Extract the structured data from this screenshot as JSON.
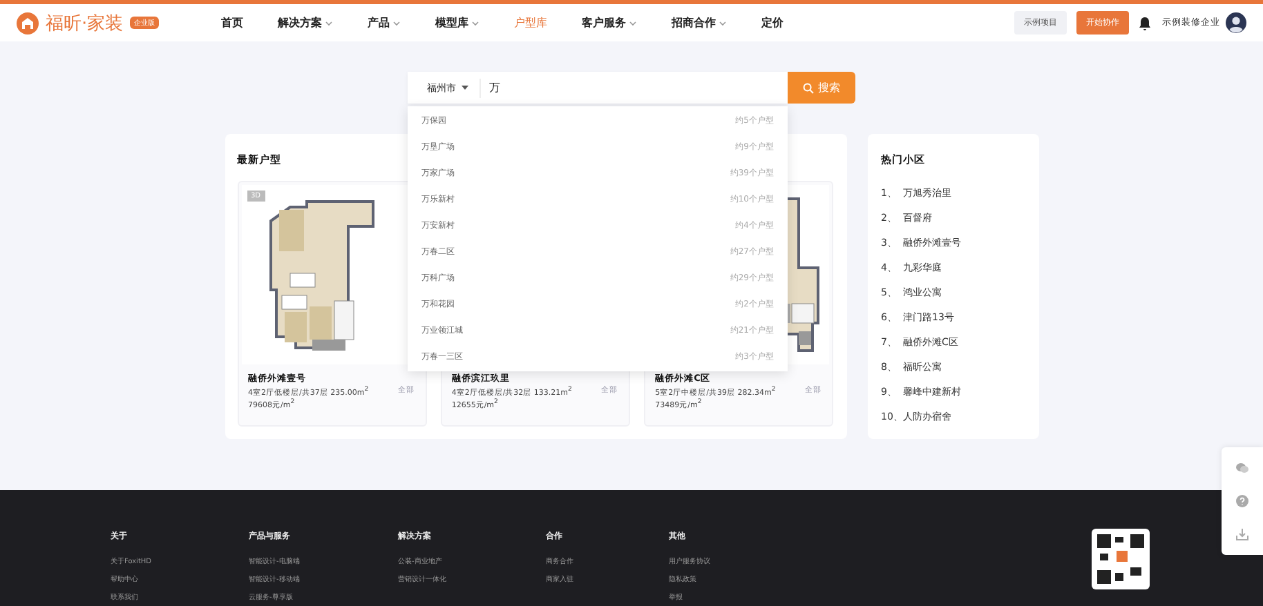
{
  "header": {
    "logo_text": "福昕·家装",
    "logo_badge": "企业版",
    "nav": [
      {
        "label": "首页",
        "selected": false,
        "caret": false
      },
      {
        "label": "解决方案",
        "selected": false,
        "caret": true
      },
      {
        "label": "产品",
        "selected": false,
        "caret": true
      },
      {
        "label": "模型库",
        "selected": false,
        "caret": true
      },
      {
        "label": "户型库",
        "selected": true,
        "caret": false
      },
      {
        "label": "客户服务",
        "selected": false,
        "caret": true
      },
      {
        "label": "招商合作",
        "selected": false,
        "caret": true
      },
      {
        "label": "定价",
        "selected": false,
        "caret": false
      }
    ],
    "demo_button": "示例项目",
    "start_button": "开始协作",
    "company": "示例装修企业"
  },
  "search": {
    "city": "福州市",
    "value": "万",
    "button": "搜索",
    "suggestions": [
      {
        "name": "万保园",
        "count": "约5个户型"
      },
      {
        "name": "万垦广场",
        "count": "约9个户型"
      },
      {
        "name": "万家广场",
        "count": "约39个户型"
      },
      {
        "name": "万乐新村",
        "count": "约10个户型"
      },
      {
        "name": "万安新村",
        "count": "约4个户型"
      },
      {
        "name": "万春二区",
        "count": "约27个户型"
      },
      {
        "name": "万科广场",
        "count": "约29个户型"
      },
      {
        "name": "万和花园",
        "count": "约2个户型"
      },
      {
        "name": "万业领江城",
        "count": "约21个户型"
      },
      {
        "name": "万春一三区",
        "count": "约3个户型"
      }
    ]
  },
  "latest": {
    "title": "最新户型",
    "cards": [
      {
        "badge": "3D",
        "name": "融侨外滩壹号",
        "info": "4室2厅低楼层/共37层 235.00m$^{2}$",
        "price": "79608元/m$^{2}$",
        "link": "全部"
      },
      {
        "name": "融侨滨江玖里",
        "info": "4室2厅低楼层/共32层 133.21m$^{2}$",
        "price": "12655元/m$^{2}$",
        "link": "全部"
      },
      {
        "name": "融侨外滩C区",
        "info": "5室2厅中楼层/共39层 282.34m$^{2}$",
        "price": "73489元/m$^{2}$",
        "link": "全部"
      }
    ]
  },
  "hot": {
    "title": "热门小区",
    "items": [
      {
        "rank": "1、",
        "name": "万旭秀治里"
      },
      {
        "rank": "2、",
        "name": "百督府"
      },
      {
        "rank": "3、",
        "name": "融侨外滩壹号"
      },
      {
        "rank": "4、",
        "name": "九彩华庭"
      },
      {
        "rank": "5、",
        "name": "鸿业公寓"
      },
      {
        "rank": "6、",
        "name": "津门路13号"
      },
      {
        "rank": "7、",
        "name": "融侨外滩C区"
      },
      {
        "rank": "8、",
        "name": "福昕公寓"
      },
      {
        "rank": "9、",
        "name": "馨峰中建新村"
      },
      {
        "rank": "10、",
        "name": "人防办宿舍"
      }
    ]
  },
  "footer": {
    "columns": [
      {
        "title": "关于",
        "links": [
          "关于FoxitHD",
          "帮助中心",
          "联系我们"
        ]
      },
      {
        "title": "产品与服务",
        "links": [
          "智能设计-电脑端",
          "智能设计-移动端",
          "云服务-尊享版"
        ]
      },
      {
        "title": "解决方案",
        "links": [
          "公装-商业地产",
          "营销设计一体化"
        ]
      },
      {
        "title": "合作",
        "links": [
          "商务合作",
          "商家入驻"
        ]
      },
      {
        "title": "其他",
        "links": [
          "用户服务协议",
          "隐私政策",
          "举报"
        ]
      }
    ]
  }
}
